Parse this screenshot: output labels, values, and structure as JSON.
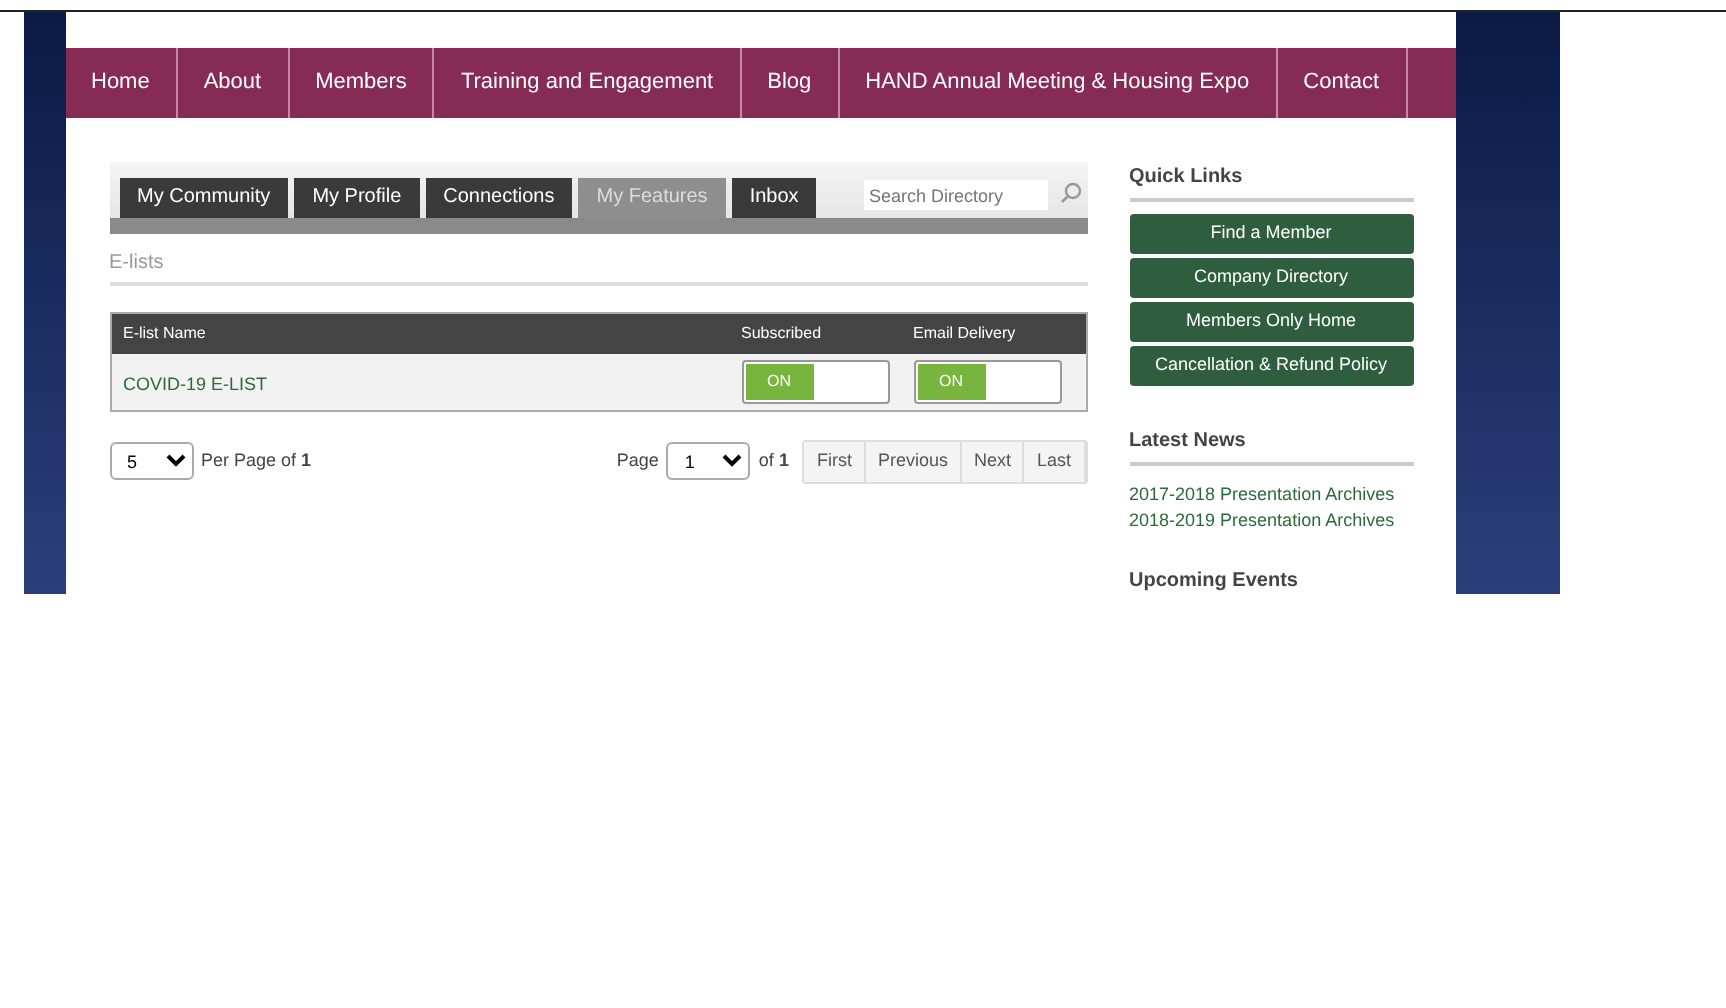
{
  "nav": [
    {
      "label": "Home"
    },
    {
      "label": "About"
    },
    {
      "label": "Members"
    },
    {
      "label": "Training and Engagement"
    },
    {
      "label": "Blog"
    },
    {
      "label": "HAND Annual Meeting & Housing Expo"
    },
    {
      "label": "Contact"
    }
  ],
  "tabs": [
    {
      "label": "My Community",
      "selected": false
    },
    {
      "label": "My Profile",
      "selected": false
    },
    {
      "label": "Connections",
      "selected": false
    },
    {
      "label": "My Features",
      "selected": true
    },
    {
      "label": "Inbox",
      "selected": false
    }
  ],
  "search": {
    "placeholder": "Search Directory"
  },
  "section_title": "E-lists",
  "table": {
    "columns": [
      "E-list Name",
      "Subscribed",
      "Email Delivery"
    ],
    "rows": [
      {
        "name": "COVID-19 E-LIST",
        "subscribed": {
          "label": "ON",
          "on": true
        },
        "email_delivery": {
          "label": "ON",
          "on": true
        }
      }
    ]
  },
  "pager": {
    "per_page": "5",
    "per_page_label": "Per Page of",
    "per_page_total": "1",
    "page_label": "Page",
    "page": "1",
    "of_label": "of",
    "page_total": "1",
    "buttons": [
      "First",
      "Previous",
      "Next",
      "Last"
    ]
  },
  "quick_links": {
    "title": "Quick Links",
    "items": [
      "Find a Member",
      "Company Directory",
      "Members Only Home",
      "Cancellation & Refund Policy"
    ]
  },
  "latest_news": {
    "title": "Latest News",
    "items": [
      "2017-2018 Presentation Archives",
      "2018-2019 Presentation Archives"
    ]
  },
  "upcoming_events": {
    "title": "Upcoming Events"
  }
}
